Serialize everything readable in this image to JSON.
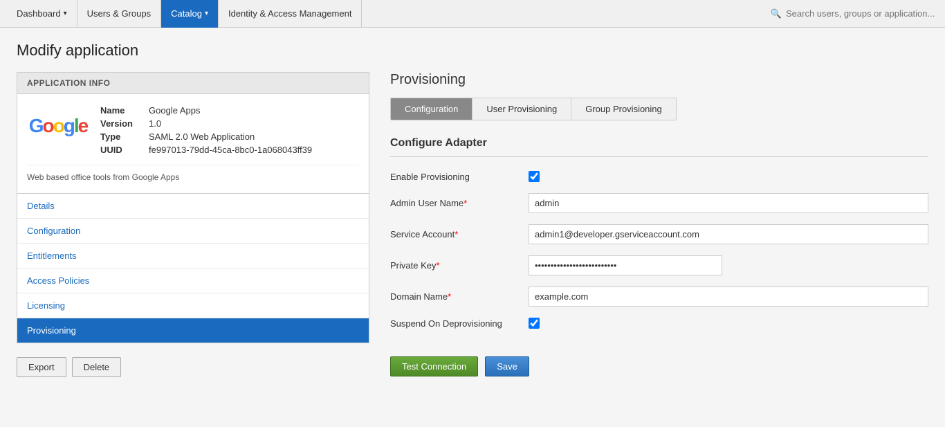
{
  "topNav": {
    "items": [
      {
        "id": "dashboard",
        "label": "Dashboard",
        "hasDropdown": true,
        "active": false
      },
      {
        "id": "users-groups",
        "label": "Users & Groups",
        "hasDropdown": false,
        "active": false
      },
      {
        "id": "catalog",
        "label": "Catalog",
        "hasDropdown": true,
        "active": true
      },
      {
        "id": "iam",
        "label": "Identity & Access Management",
        "hasDropdown": false,
        "active": false
      }
    ],
    "searchPlaceholder": "Search users, groups or application..."
  },
  "pageTitle": "Modify application",
  "appInfo": {
    "sectionLabel": "APPLICATION INFO",
    "nameLabel": "Name",
    "nameValue": "Google Apps",
    "versionLabel": "Version",
    "versionValue": "1.0",
    "typeLabel": "Type",
    "typeValue": "SAML 2.0 Web Application",
    "uuidLabel": "UUID",
    "uuidValue": "fe997013-79dd-45ca-8bc0-1a068043ff39",
    "description": "Web based office tools from Google Apps"
  },
  "sideNav": [
    {
      "id": "details",
      "label": "Details",
      "active": false
    },
    {
      "id": "configuration",
      "label": "Configuration",
      "active": false
    },
    {
      "id": "entitlements",
      "label": "Entitlements",
      "active": false
    },
    {
      "id": "access-policies",
      "label": "Access Policies",
      "active": false
    },
    {
      "id": "licensing",
      "label": "Licensing",
      "active": false
    },
    {
      "id": "provisioning",
      "label": "Provisioning",
      "active": true
    }
  ],
  "bottomButtons": {
    "export": "Export",
    "delete": "Delete"
  },
  "provisioning": {
    "title": "Provisioning",
    "tabs": [
      {
        "id": "configuration",
        "label": "Configuration",
        "active": true
      },
      {
        "id": "user-provisioning",
        "label": "User Provisioning",
        "active": false
      },
      {
        "id": "group-provisioning",
        "label": "Group Provisioning",
        "active": false
      }
    ],
    "configureTitle": "Configure Adapter",
    "fields": {
      "enableProvisioning": {
        "label": "Enable Provisioning",
        "checked": true
      },
      "adminUserName": {
        "label": "Admin User Name",
        "required": true,
        "value": "admin"
      },
      "serviceAccount": {
        "label": "Service Account",
        "required": true,
        "value": "admin1@developer.gserviceaccount.com"
      },
      "privateKey": {
        "label": "Private Key",
        "required": true,
        "value": "••••••••••••••••••••••••••"
      },
      "domainName": {
        "label": "Domain Name",
        "required": true,
        "value": "example.com"
      },
      "suspendOnDeprovisioning": {
        "label": "Suspend On Deprovisioning",
        "checked": true
      }
    },
    "testConnectionLabel": "Test Connection",
    "saveLabel": "Save"
  }
}
